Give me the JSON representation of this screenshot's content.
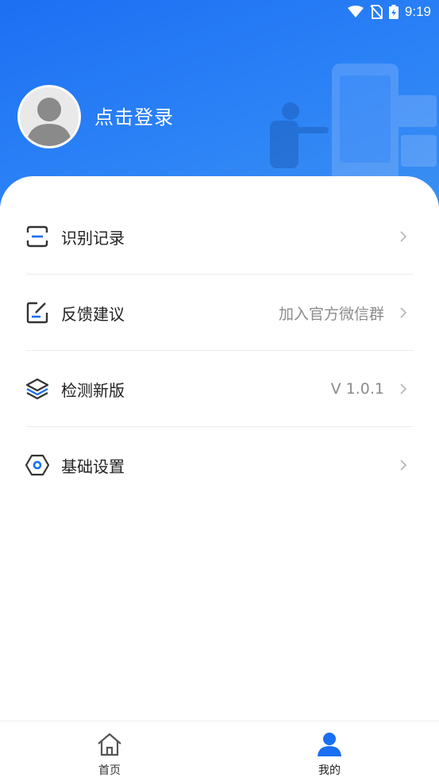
{
  "statusbar": {
    "time": "9:19"
  },
  "profile": {
    "login_label": "点击登录"
  },
  "menu": [
    {
      "label": "识别记录",
      "value": ""
    },
    {
      "label": "反馈建议",
      "value": "加入官方微信群"
    },
    {
      "label": "检测新版",
      "value": "V 1.0.1"
    },
    {
      "label": "基础设置",
      "value": ""
    }
  ],
  "tabbar": {
    "home_label": "首页",
    "mine_label": "我的",
    "active_color": "#1a6ff2",
    "inactive_color": "#333333"
  }
}
